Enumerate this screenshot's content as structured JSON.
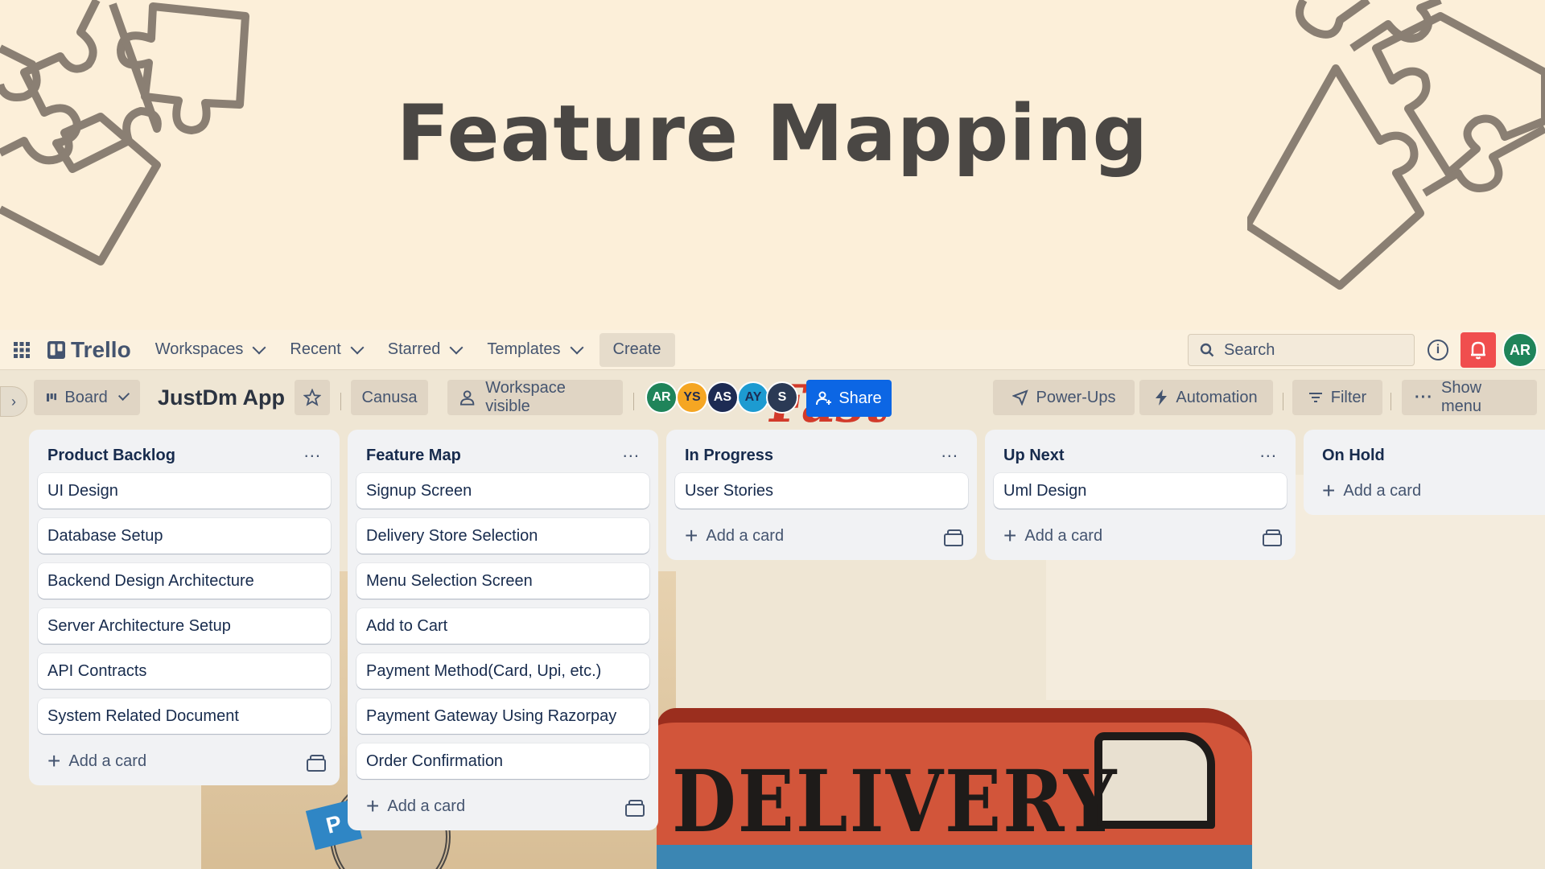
{
  "slide": {
    "title": "Feature Mapping"
  },
  "nav": {
    "brand": "Trello",
    "menus": [
      "Workspaces",
      "Recent",
      "Starred",
      "Templates"
    ],
    "create_label": "Create",
    "search_placeholder": "Search",
    "user_initials": "AR",
    "icons": [
      "app-switcher-icon",
      "trello-logo-icon",
      "search-icon",
      "info-icon",
      "bell-icon"
    ]
  },
  "board": {
    "view_label": "Board",
    "title": "JustDm App",
    "workspace_name": "Canusa",
    "visibility_label": "Workspace visible",
    "members": [
      {
        "initials": "AR",
        "color": "#1f845a"
      },
      {
        "initials": "YS",
        "color": "#f5a623"
      },
      {
        "initials": "AS",
        "color": "#1d2b53"
      },
      {
        "initials": "AY",
        "color": "#1d9bd1"
      },
      {
        "initials": "S",
        "color": "#2b3a55"
      }
    ],
    "share_label": "Share",
    "powerups_label": "Power-Ups",
    "automation_label": "Automation",
    "filter_label": "Filter",
    "show_menu_label": "Show menu"
  },
  "lists": [
    {
      "title": "Product Backlog",
      "cards": [
        "UI Design",
        "Database Setup",
        "Backend Design Architecture",
        "Server Architecture Setup",
        "API Contracts",
        "System Related Document"
      ],
      "add_label": "Add a card"
    },
    {
      "title": "Feature Map",
      "cards": [
        "Signup Screen",
        "Delivery Store Selection",
        "Menu Selection Screen",
        "Add to Cart",
        "Payment Method(Card, Upi, etc.)",
        "Payment Gateway Using Razorpay",
        "Order Confirmation"
      ],
      "add_label": "Add a card"
    },
    {
      "title": "In Progress",
      "cards": [
        "User Stories"
      ],
      "add_label": "Add a card"
    },
    {
      "title": "Up Next",
      "cards": [
        "Uml Design"
      ],
      "add_label": "Add a card"
    },
    {
      "title": "On Hold",
      "cards": [],
      "add_label": "Add a card"
    }
  ],
  "background_art": {
    "van_text": "DELIVERY",
    "ribbon_text": "P",
    "sign_text": "Fast"
  }
}
